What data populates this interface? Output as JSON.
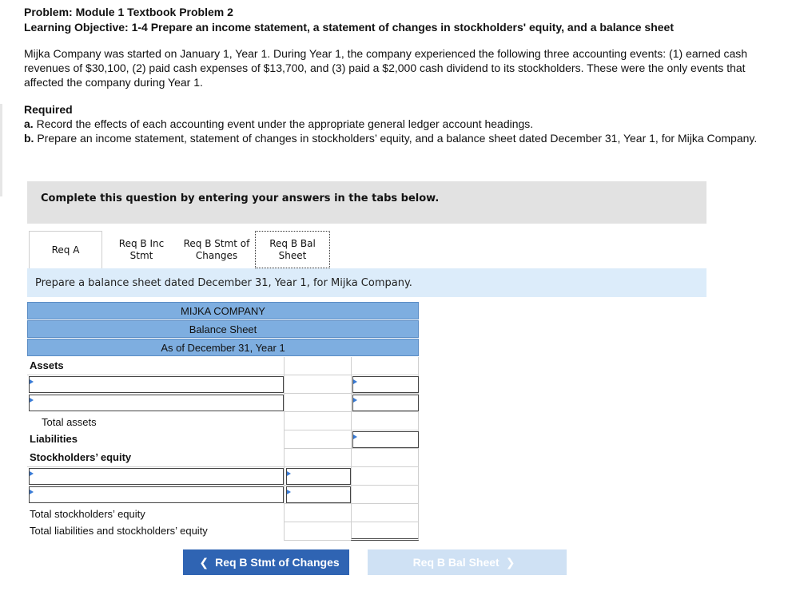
{
  "header": {
    "problem_title": "Problem: Module 1 Textbook Problem 2",
    "learning_objective": "Learning Objective: 1-4 Prepare an income statement, a statement of changes in stockholders' equity, and a balance sheet",
    "problem_text": "Mijka Company was started on January 1, Year 1. During Year 1, the company experienced the following three accounting events: (1) earned cash revenues of $30,100, (2) paid cash expenses of $13,700, and (3) paid a $2,000 cash dividend to its stockholders. These were the only events that affected the company during Year 1.",
    "required_label": "Required",
    "req_a_prefix": "a.",
    "req_a_text": " Record the effects of each accounting event under the appropriate general ledger account headings.",
    "req_b_prefix": "b.",
    "req_b_text": " Prepare an income statement, statement of changes in stockholders’ equity, and a balance sheet dated December 31, Year 1, for Mijka Company."
  },
  "complete_text": "Complete this question by entering your answers in the tabs below.",
  "tabs": [
    {
      "label_line1": "Req A",
      "label_line2": ""
    },
    {
      "label_line1": "Req B Inc",
      "label_line2": "Stmt"
    },
    {
      "label_line1": "Req B Stmt of",
      "label_line2": "Changes"
    },
    {
      "label_line1": "Req B Bal",
      "label_line2": "Sheet"
    }
  ],
  "instruction": "Prepare a balance sheet dated December 31, Year 1, for Mijka Company.",
  "statement": {
    "company": "MIJKA COMPANY",
    "title": "Balance Sheet",
    "date": "As of December 31, Year 1",
    "assets_label": "Assets",
    "total_assets_label": "Total assets",
    "liabilities_label": "Liabilities",
    "equity_label": "Stockholders’ equity",
    "total_equity_label": "Total stockholders’ equity",
    "total_liab_equity_label": "Total liabilities and stockholders’ equity"
  },
  "nav": {
    "prev_label": "Req B Stmt of Changes",
    "next_label": "Req B Bal Sheet"
  },
  "colors": {
    "header_blue": "#7eaee0",
    "instruction_bg": "#dcecfa",
    "prev_button": "#2f64b3",
    "next_button_disabled": "#cfe1f4",
    "input_arrow": "#3a7bd5"
  }
}
